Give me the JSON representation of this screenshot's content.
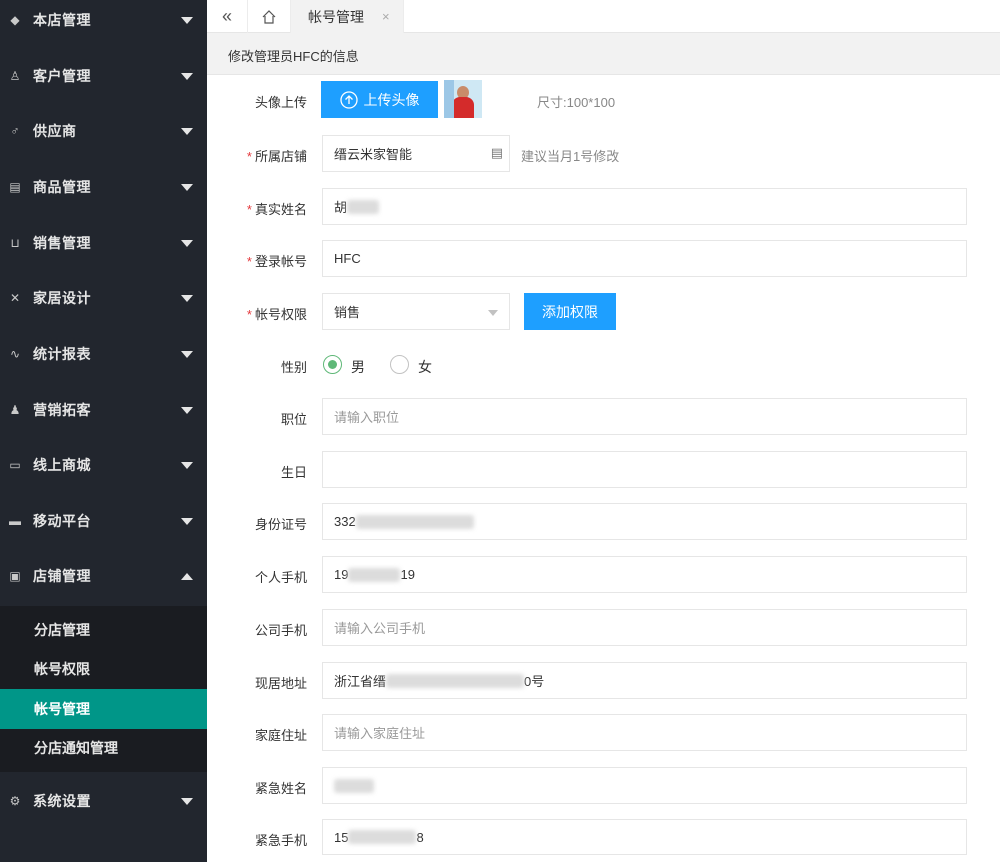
{
  "sidebar": {
    "items": [
      {
        "label": "本店管理",
        "icon": "diamond-icon"
      },
      {
        "label": "客户管理",
        "icon": "user-icon"
      },
      {
        "label": "供应商",
        "icon": "male-icon"
      },
      {
        "label": "商品管理",
        "icon": "document-icon"
      },
      {
        "label": "销售管理",
        "icon": "cart-icon"
      },
      {
        "label": "家居设计",
        "icon": "tools-icon"
      },
      {
        "label": "统计报表",
        "icon": "pulse-icon"
      },
      {
        "label": "营销拓客",
        "icon": "users-icon"
      },
      {
        "label": "线上商城",
        "icon": "window-icon"
      },
      {
        "label": "移动平台",
        "icon": "screen-icon"
      },
      {
        "label": "店铺管理",
        "icon": "store-icon"
      }
    ],
    "submenu": [
      {
        "label": "分店管理"
      },
      {
        "label": "帐号权限"
      },
      {
        "label": "帐号管理"
      },
      {
        "label": "分店通知管理"
      }
    ],
    "settings": {
      "label": "系统设置",
      "icon": "gear-icon"
    }
  },
  "tabs": {
    "active_label": "帐号管理",
    "close_glyph": "×",
    "collapse_glyph": "«"
  },
  "header": {
    "title": "修改管理员HFC的信息"
  },
  "form": {
    "avatar": {
      "label": "头像上传",
      "button": "上传头像",
      "hint": "尺寸:100*100"
    },
    "store": {
      "label": "所属店铺",
      "value": "缙云米家智能",
      "hint": "建议当月1号修改"
    },
    "realname": {
      "label": "真实姓名",
      "value": "胡"
    },
    "login": {
      "label": "登录帐号",
      "value": "HFC"
    },
    "permission": {
      "label": "帐号权限",
      "value": "销售",
      "button": "添加权限"
    },
    "gender": {
      "label": "性别",
      "male": "男",
      "female": "女",
      "selected": "男"
    },
    "position": {
      "label": "职位",
      "placeholder": "请输入职位"
    },
    "birthday": {
      "label": "生日",
      "value": ""
    },
    "idcard": {
      "label": "身份证号",
      "value": "332"
    },
    "mobile": {
      "label": "个人手机",
      "prefix": "19",
      "suffix": "19"
    },
    "company_mobile": {
      "label": "公司手机",
      "placeholder": "请输入公司手机"
    },
    "address": {
      "label": "现居地址",
      "prefix": "浙江省缙",
      "suffix": "0号"
    },
    "home_address": {
      "label": "家庭住址",
      "placeholder": "请输入家庭住址"
    },
    "emergency_name": {
      "label": "紧急姓名",
      "value": ""
    },
    "emergency_mobile": {
      "label": "紧急手机",
      "prefix": "15",
      "suffix": "8"
    }
  },
  "colors": {
    "sidebar_bg": "#22262e",
    "active_green": "#009688",
    "accent_blue": "#1e9fff",
    "radio_green": "#5fb878",
    "required_red": "#e4393c"
  }
}
